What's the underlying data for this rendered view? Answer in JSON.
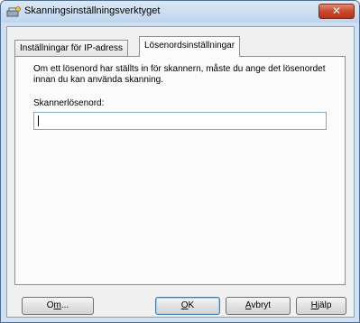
{
  "window": {
    "title": "Skanningsinställningsverktyget",
    "close_glyph": "✕"
  },
  "tabs": [
    {
      "label": "Inställningar för IP-adress",
      "active": false
    },
    {
      "label": "Lösenordsinställningar",
      "active": true
    }
  ],
  "panel": {
    "info_text": "Om ett lösenord har ställts in för skannern, måste du ange det lösenordet innan du kan använda skanning.",
    "password_label": "Skannerlösenord:",
    "password_value": ""
  },
  "buttons": {
    "about": {
      "prefix": "O",
      "mnemonic": "m",
      "suffix": "..."
    },
    "ok": {
      "prefix": "",
      "mnemonic": "O",
      "suffix": "K"
    },
    "cancel": {
      "prefix": "",
      "mnemonic": "A",
      "suffix": "vbryt"
    },
    "help": {
      "prefix": "",
      "mnemonic": "H",
      "suffix": "jälp"
    }
  },
  "colors": {
    "titlebar": "#cfe0f1",
    "close_button": "#c74a2f",
    "input_border": "#7fa7d3",
    "default_button_border": "#3c7fb1"
  },
  "icons": {
    "app": "scanner-settings-icon",
    "close": "close-icon"
  }
}
